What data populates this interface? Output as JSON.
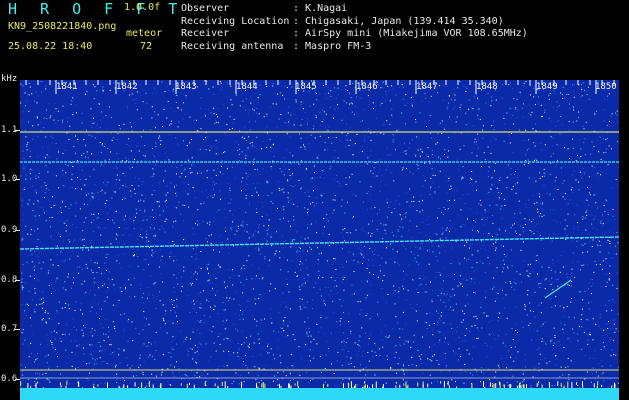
{
  "app": {
    "name": "H R O F F T",
    "version": "1.0.0f",
    "filename": "KN9_2508221840.png",
    "mode": "meteor",
    "datetime": "25.08.22 18:40",
    "count": "72"
  },
  "info": [
    {
      "key": "Observer",
      "value": ": K.Nagai"
    },
    {
      "key": "Receiving Location",
      "value": ": Chigasaki, Japan (139.414 35.340)"
    },
    {
      "key": "Receiver",
      "value": ": AirSpy mini (Miakejima VOR 108.65MHz)"
    },
    {
      "key": "Receiving antenna",
      "value": ": Maspro FM-3"
    }
  ],
  "axis": {
    "y_unit": "kHz",
    "y_ticks": [
      "1.1",
      "1.0",
      "0.9",
      "0.8",
      "0.7",
      "0.6"
    ],
    "x_ticks": [
      "1841",
      "1842",
      "1843",
      "1844",
      "1845",
      "1846",
      "1847",
      "1848",
      "1849",
      "1850"
    ]
  },
  "colors": {
    "background": "#0a2aa8",
    "line_yellow": "#d8e070",
    "line_cyan": "#40e8e8",
    "noise_white": "#ffffff",
    "noise_cyan": "#3ce0ff"
  }
}
